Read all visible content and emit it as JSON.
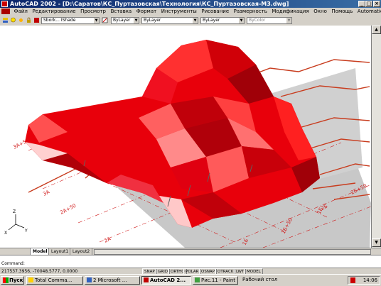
{
  "window": {
    "title": "AutoCAD 2002 - [D:\\Саратов\\КС_Пуртазовская\\Технология\\КС_Пуртазовская-М3.dwg]",
    "buttons": [
      "_",
      "□",
      "×"
    ]
  },
  "menu": {
    "items": [
      "Файл",
      "Редактирование",
      "Просмотр",
      "Вставка",
      "Формат",
      "Инструменты",
      "Рисование",
      "Размерность",
      "Модификация",
      "Окно",
      "Помощь",
      "AutomaticCS"
    ]
  },
  "toolbar": {
    "style_combo": "Sbork... IShade",
    "layer_combo": "ByLayer",
    "linetype_combo": "ByLayer",
    "lineweight_combo": "ByLayer",
    "plotstyle_combo": "ByColor"
  },
  "drawing": {
    "colors": {
      "roof_main": "#e8000b",
      "roof_dark": "#b00008",
      "roof_light": "#ff7070",
      "shadow": "#c8c8c8",
      "pipe": "#c83c1e",
      "grid": "#d01818"
    },
    "grid_labels": [
      "3А+50",
      "3А",
      "2А+50",
      "2А",
      "2Б",
      "2Б+50",
      "1Б",
      "1Б+50",
      "1Б"
    ],
    "ucs": {
      "x": "X",
      "y": "Y",
      "z": "Z"
    }
  },
  "tabs": [
    "Model",
    "Layout1",
    "Layout2"
  ],
  "command": {
    "line1": "Command:",
    "line2": ""
  },
  "status": {
    "coords": "217537.3956, -70048.5777, 0.0000",
    "buttons": [
      "SNAP",
      "GRID",
      "ORTHO",
      "POLAR",
      "OSNAP",
      "OTRACK",
      "LWT",
      "MODEL"
    ]
  },
  "taskbar": {
    "start": "Пуск",
    "tasks": [
      "Total Comma...",
      "2 Microsoft ...",
      "AutoCAD 2...",
      "Рис.11 - Paint",
      "Рабочий стол"
    ],
    "clock": "14:06"
  }
}
